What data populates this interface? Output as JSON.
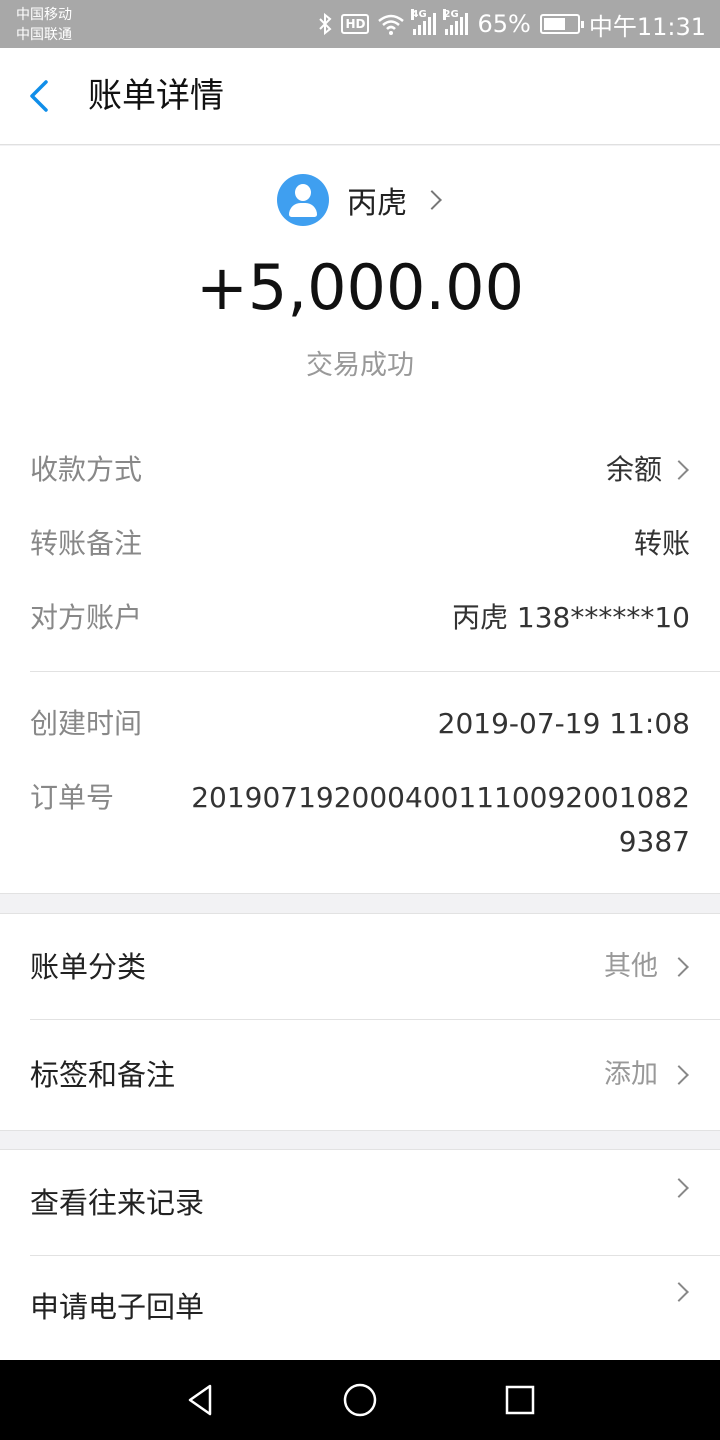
{
  "status_bar": {
    "carrier_1": "中国移动",
    "carrier_2": "中国联通",
    "hd": "HD",
    "net_1": "4G",
    "net_2": "2G",
    "battery": "65%",
    "battery_level": 0.65,
    "time": "中午11:31"
  },
  "header": {
    "title": "账单详情"
  },
  "payee": {
    "name": "丙虎"
  },
  "amount": "+5,000.00",
  "status": "交易成功",
  "details": [
    {
      "label": "收款方式",
      "value": "余额"
    },
    {
      "label": "转账备注",
      "value": "转账"
    },
    {
      "label": "对方账户",
      "value": "丙虎 138******10"
    },
    {
      "label": "创建时间",
      "value": "2019-07-19 11:08"
    },
    {
      "label": "订单号",
      "value": "2019071920004001110092001082938 7"
    }
  ],
  "order_no": "20190719200040011100920010829387",
  "menu1": [
    {
      "label": "账单分类",
      "value": "其他"
    },
    {
      "label": "标签和备注",
      "value": "添加"
    }
  ],
  "menu2": [
    {
      "label": "查看往来记录"
    },
    {
      "label": "申请电子回单"
    }
  ],
  "colors": {
    "accent": "#108ee9",
    "avatar": "#3f9ff0",
    "status_bar": "#a8a8a8",
    "nav_bar": "#000000"
  },
  "icons": [
    "bluetooth-icon",
    "wifi-icon",
    "signal-icon",
    "battery-icon",
    "back-icon",
    "avatar-icon",
    "chevron-right-icon",
    "nav-back-icon",
    "nav-home-icon",
    "nav-recents-icon"
  ]
}
